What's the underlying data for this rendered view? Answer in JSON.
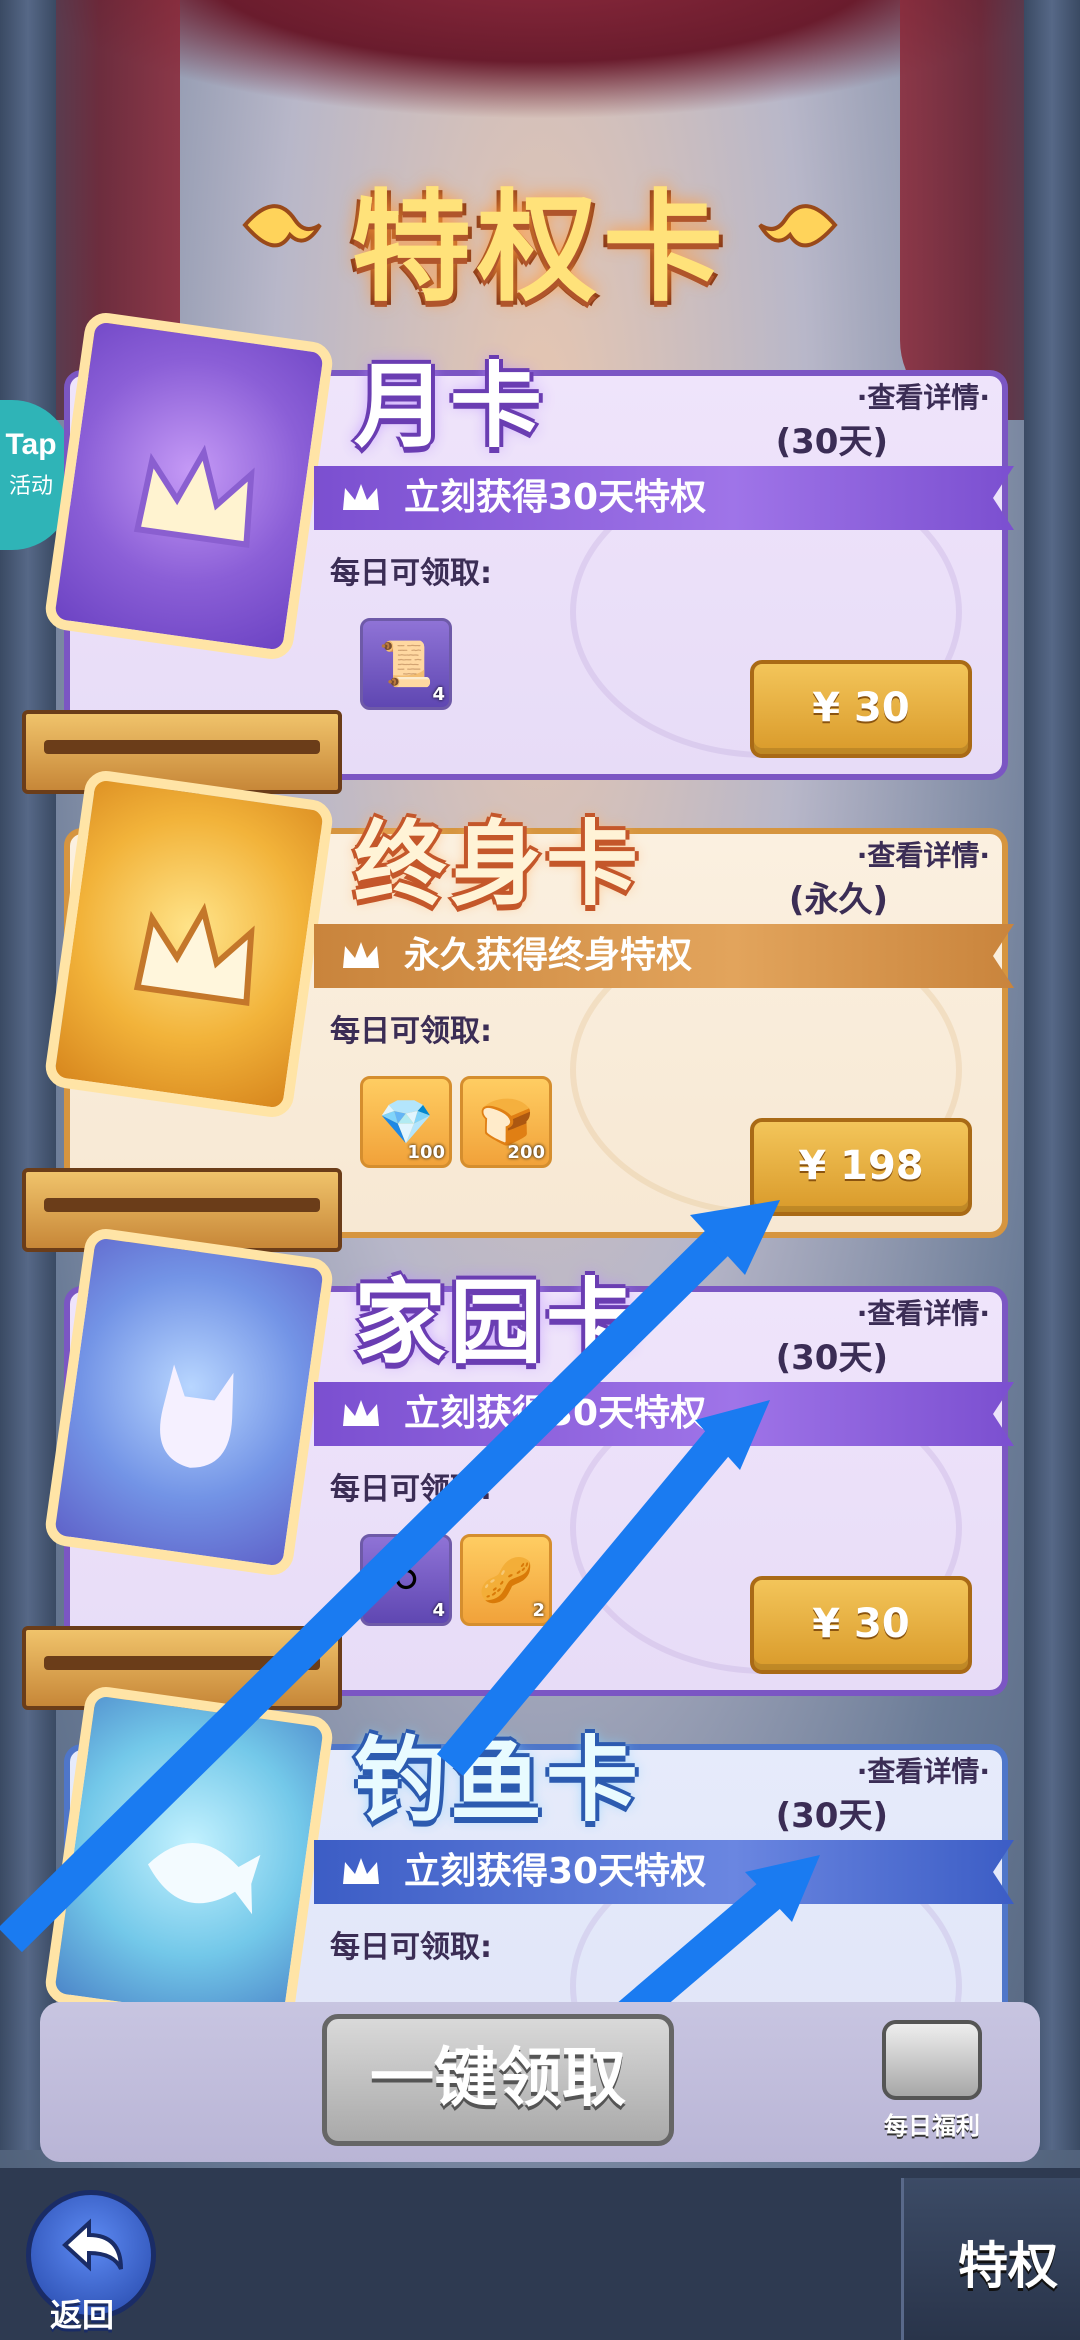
{
  "page": {
    "title": "特权卡",
    "tap_badge": {
      "line1": "Tap",
      "line2": "活动"
    }
  },
  "cards": [
    {
      "name": "月卡",
      "detail_link": "·查看详情·",
      "duration": "(30天)",
      "ribbon": "立刻获得30天特权",
      "daily_label": "每日可领取:",
      "items": [
        {
          "icon": "scroll-icon",
          "qty": "4"
        }
      ],
      "price": "¥ 30"
    },
    {
      "name": "终身卡",
      "detail_link": "·查看详情·",
      "duration": "(永久)",
      "ribbon": "永久获得终身特权",
      "daily_label": "每日可领取:",
      "items": [
        {
          "icon": "diamond-icon",
          "qty": "100"
        },
        {
          "icon": "bread-icon",
          "qty": "200"
        }
      ],
      "price": "¥ 198"
    },
    {
      "name": "家园卡",
      "detail_link": "·查看详情·",
      "duration": "(30天)",
      "ribbon": "立刻获得30天特权",
      "daily_label": "每日可领取:",
      "items": [
        {
          "icon": "pebbles-icon",
          "qty": "4"
        },
        {
          "icon": "nuts-icon",
          "qty": "2"
        }
      ],
      "price": "¥ 30"
    },
    {
      "name": "钓鱼卡",
      "detail_link": "·查看详情·",
      "duration": "(30天)",
      "ribbon": "立刻获得30天特权",
      "daily_label": "每日可领取:"
    }
  ],
  "actions": {
    "claim_all": "一键领取",
    "daily_welfare": "每日福利"
  },
  "nav": {
    "back": "返回",
    "privilege_tab": "特权"
  },
  "colors": {
    "arrow": "#1a7bf1",
    "buy_button": "#e2aa3c"
  }
}
